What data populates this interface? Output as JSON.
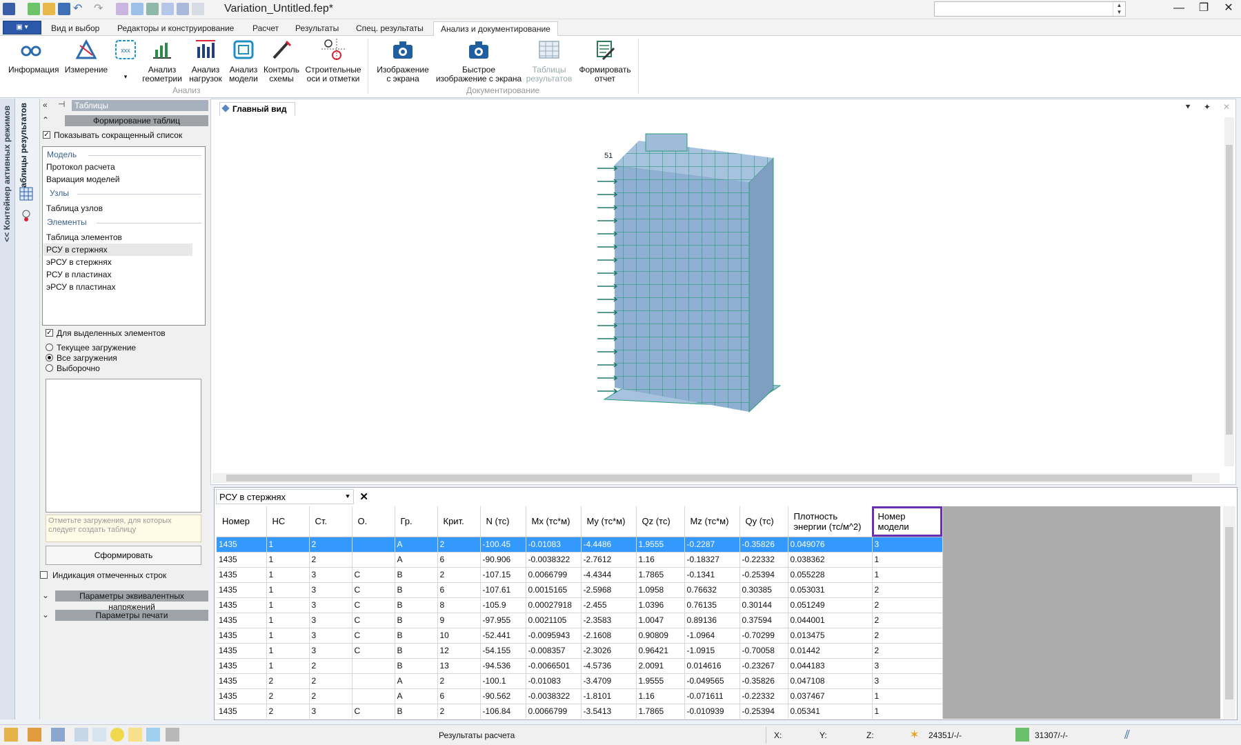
{
  "window": {
    "title": "Variation_Untitled.fep*",
    "controls": [
      "—",
      "❐",
      "✕"
    ]
  },
  "menu_tabs": [
    "Вид и выбор",
    "Редакторы и конструирование",
    "Расчет",
    "Результаты",
    "Спец. результаты",
    "Анализ и документирование"
  ],
  "active_tab": "Анализ и документирование",
  "ribbon": {
    "analysis_group_label": "Анализ",
    "doc_group_label": "Документирование",
    "buttons": {
      "info": "Информация",
      "measure": "Измерение",
      "geom1": "Анализ",
      "geom2": "геометрии",
      "load1": "Анализ",
      "load2": "нагрузок",
      "model1": "Анализ",
      "model2": "модели",
      "ctrl1": "Контроль",
      "ctrl2": "схемы",
      "axes1": "Строительные",
      "axes2": "оси и отметки",
      "shot1": "Изображение",
      "shot2": "с экрана",
      "quick1": "Быстрое",
      "quick2": "изображение с экрана",
      "tables1": "Таблицы",
      "tables2": "результатов",
      "report1": "Формировать",
      "report2": "отчет"
    }
  },
  "side": {
    "container_label": "<< Контейнер активных режимов",
    "results_label": "Таблицы результатов"
  },
  "panel": {
    "title": "Таблицы",
    "section_build": "Формирование таблиц",
    "short_list": "Показывать сокращенный список",
    "sections": {
      "model": "Модель",
      "nodes": "Узлы",
      "elements": "Элементы"
    },
    "items": {
      "protocol": "Протокол расчета",
      "variation": "Вариация моделей",
      "node_table": "Таблица узлов",
      "elem_table": "Таблица элементов",
      "rsu_bars": "РСУ в стержнях",
      "ersu_bars": "эРСУ в стержнях",
      "rsu_plates": "РСУ в пластинах",
      "ersu_plates": "эРСУ в пластинах"
    },
    "for_selected": "Для выделенных элементов",
    "radio_current": "Текущее загружение",
    "radio_all": "Все загружения",
    "radio_select": "Выборочно",
    "hint": "Отметьте загружения, для которых следует создать таблицу",
    "build_button": "Сформировать",
    "marked_rows": "Индикация отмеченных строк",
    "equiv_params": "Параметры эквивалентных напряжений",
    "print_params": "Параметры печати"
  },
  "view": {
    "tab": "Главный вид",
    "floor_label": "51"
  },
  "table": {
    "tab": "РСУ в стержнях",
    "columns": [
      "Номер",
      "НС",
      "Ст.",
      "О.",
      "Гр.",
      "Крит.",
      "N (тс)",
      "Mx (тс*м)",
      "My (тс*м)",
      "Qz (тс)",
      "Mz (тс*м)",
      "Qy (тс)",
      "Плотность\nэнергии (тс/м^2)",
      "Номер\nмодели"
    ],
    "rows": [
      [
        "1435",
        "1",
        "2",
        "",
        "A",
        "2",
        "-100.45",
        "-0.01083",
        "-4.4486",
        "1.9555",
        "-0.2287",
        "-0.35826",
        "0.049076",
        "3"
      ],
      [
        "1435",
        "1",
        "2",
        "",
        "A",
        "6",
        "-90.906",
        "-0.0038322",
        "-2.7612",
        "1.16",
        "-0.18327",
        "-0.22332",
        "0.038362",
        "1"
      ],
      [
        "1435",
        "1",
        "3",
        "C",
        "B",
        "2",
        "-107.15",
        "0.0066799",
        "-4.4344",
        "1.7865",
        "-0.1341",
        "-0.25394",
        "0.055228",
        "1"
      ],
      [
        "1435",
        "1",
        "3",
        "C",
        "B",
        "6",
        "-107.61",
        "0.0015165",
        "-2.5968",
        "1.0958",
        "0.76632",
        "0.30385",
        "0.053031",
        "2"
      ],
      [
        "1435",
        "1",
        "3",
        "C",
        "B",
        "8",
        "-105.9",
        "0.00027918",
        "-2.455",
        "1.0396",
        "0.76135",
        "0.30144",
        "0.051249",
        "2"
      ],
      [
        "1435",
        "1",
        "3",
        "C",
        "B",
        "9",
        "-97.955",
        "0.0021105",
        "-2.3583",
        "1.0047",
        "0.89136",
        "0.37594",
        "0.044001",
        "2"
      ],
      [
        "1435",
        "1",
        "3",
        "C",
        "B",
        "10",
        "-52.441",
        "-0.0095943",
        "-2.1608",
        "0.90809",
        "-1.0964",
        "-0.70299",
        "0.013475",
        "2"
      ],
      [
        "1435",
        "1",
        "3",
        "C",
        "B",
        "12",
        "-54.155",
        "-0.008357",
        "-2.3026",
        "0.96421",
        "-1.0915",
        "-0.70058",
        "0.01442",
        "2"
      ],
      [
        "1435",
        "1",
        "2",
        "",
        "B",
        "13",
        "-94.536",
        "-0.0066501",
        "-4.5736",
        "2.0091",
        "0.014616",
        "-0.23267",
        "0.044183",
        "3"
      ],
      [
        "1435",
        "2",
        "2",
        "",
        "A",
        "2",
        "-100.1",
        "-0.01083",
        "-3.4709",
        "1.9555",
        "-0.049565",
        "-0.35826",
        "0.047108",
        "3"
      ],
      [
        "1435",
        "2",
        "2",
        "",
        "A",
        "6",
        "-90.562",
        "-0.0038322",
        "-1.8101",
        "1.16",
        "-0.071611",
        "-0.22332",
        "0.037467",
        "1"
      ],
      [
        "1435",
        "2",
        "3",
        "C",
        "B",
        "2",
        "-106.84",
        "0.0066799",
        "-3.5413",
        "1.7865",
        "-0.010939",
        "-0.25394",
        "0.05341",
        "1"
      ]
    ]
  },
  "status": {
    "center": "Результаты расчета",
    "x": "X:",
    "y": "Y:",
    "z": "Z:",
    "counter1": "24351/-/-",
    "counter2": "31307/-/-"
  },
  "colors": {
    "selection": "#3399ff",
    "highlight_outline": "#6b2fb3",
    "building": "#8fb0d2",
    "mesh": "#2a9d7a"
  }
}
